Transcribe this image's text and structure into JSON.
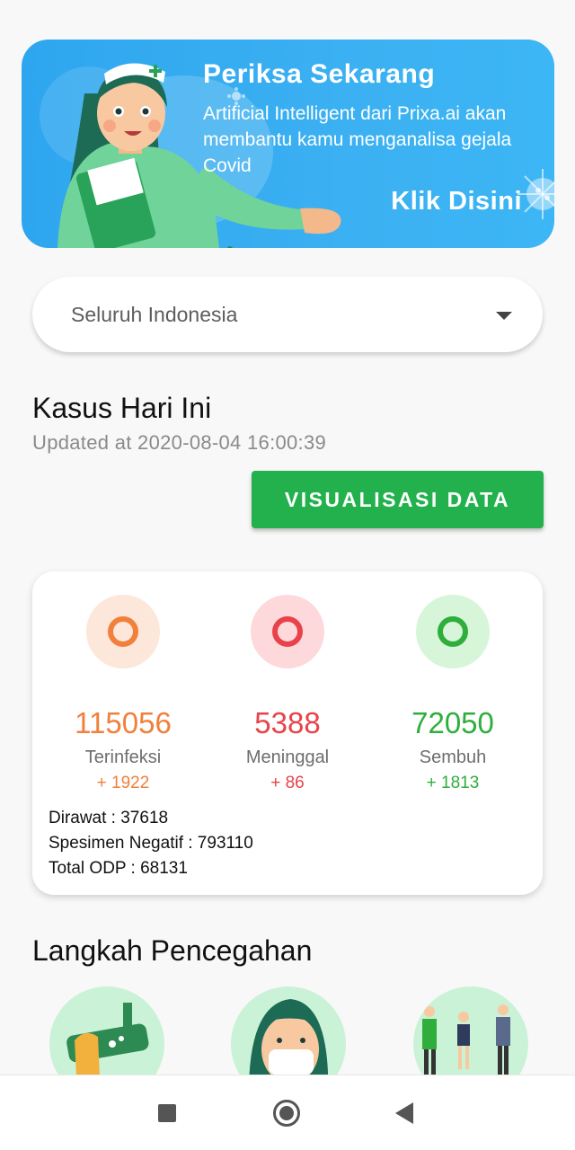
{
  "banner": {
    "title": "Periksa Sekarang",
    "description": "Artificial Intelligent dari Prixa.ai akan membantu kamu menganalisa gejala Covid",
    "cta": "Klik Disini"
  },
  "region_select": {
    "selected": "Seluruh Indonesia"
  },
  "today": {
    "title": "Kasus Hari Ini",
    "updated": "Updated at 2020-08-04 16:00:39",
    "visualize_button": "VISUALISASI DATA"
  },
  "stats": [
    {
      "value": "115056",
      "label": "Terinfeksi",
      "delta": "+ 1922",
      "color": "#f0803c",
      "bg": "#fde6da"
    },
    {
      "value": "5388",
      "label": "Meninggal",
      "delta": "+ 86",
      "color": "#e8434a",
      "bg": "#fdd9dc"
    },
    {
      "value": "72050",
      "label": "Sembuh",
      "delta": "+ 1813",
      "color": "#2fae3c",
      "bg": "#d6f5d9"
    }
  ],
  "details": [
    "Dirawat : 37618",
    "Spesimen Negatif : 793110",
    "Total ODP : 68131"
  ],
  "prevention": {
    "title": "Langkah Pencegahan"
  },
  "icons": {
    "nurse": "nurse-illustration",
    "virus": "virus-icon",
    "dropdown": "caret-down-icon",
    "nav_recent": "square-icon",
    "nav_home": "circle-icon",
    "nav_back": "triangle-back-icon"
  }
}
